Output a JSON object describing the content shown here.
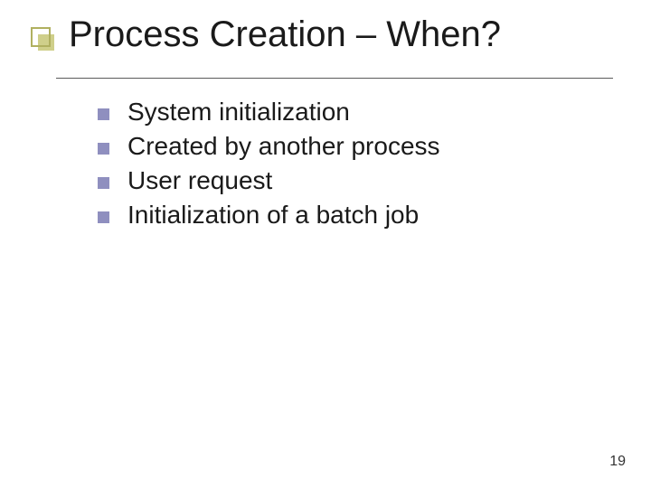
{
  "slide": {
    "title": "Process Creation – When?",
    "bullets": [
      "System initialization",
      "Created by another process",
      "User request",
      "Initialization of a batch job"
    ],
    "page_number": "19"
  }
}
